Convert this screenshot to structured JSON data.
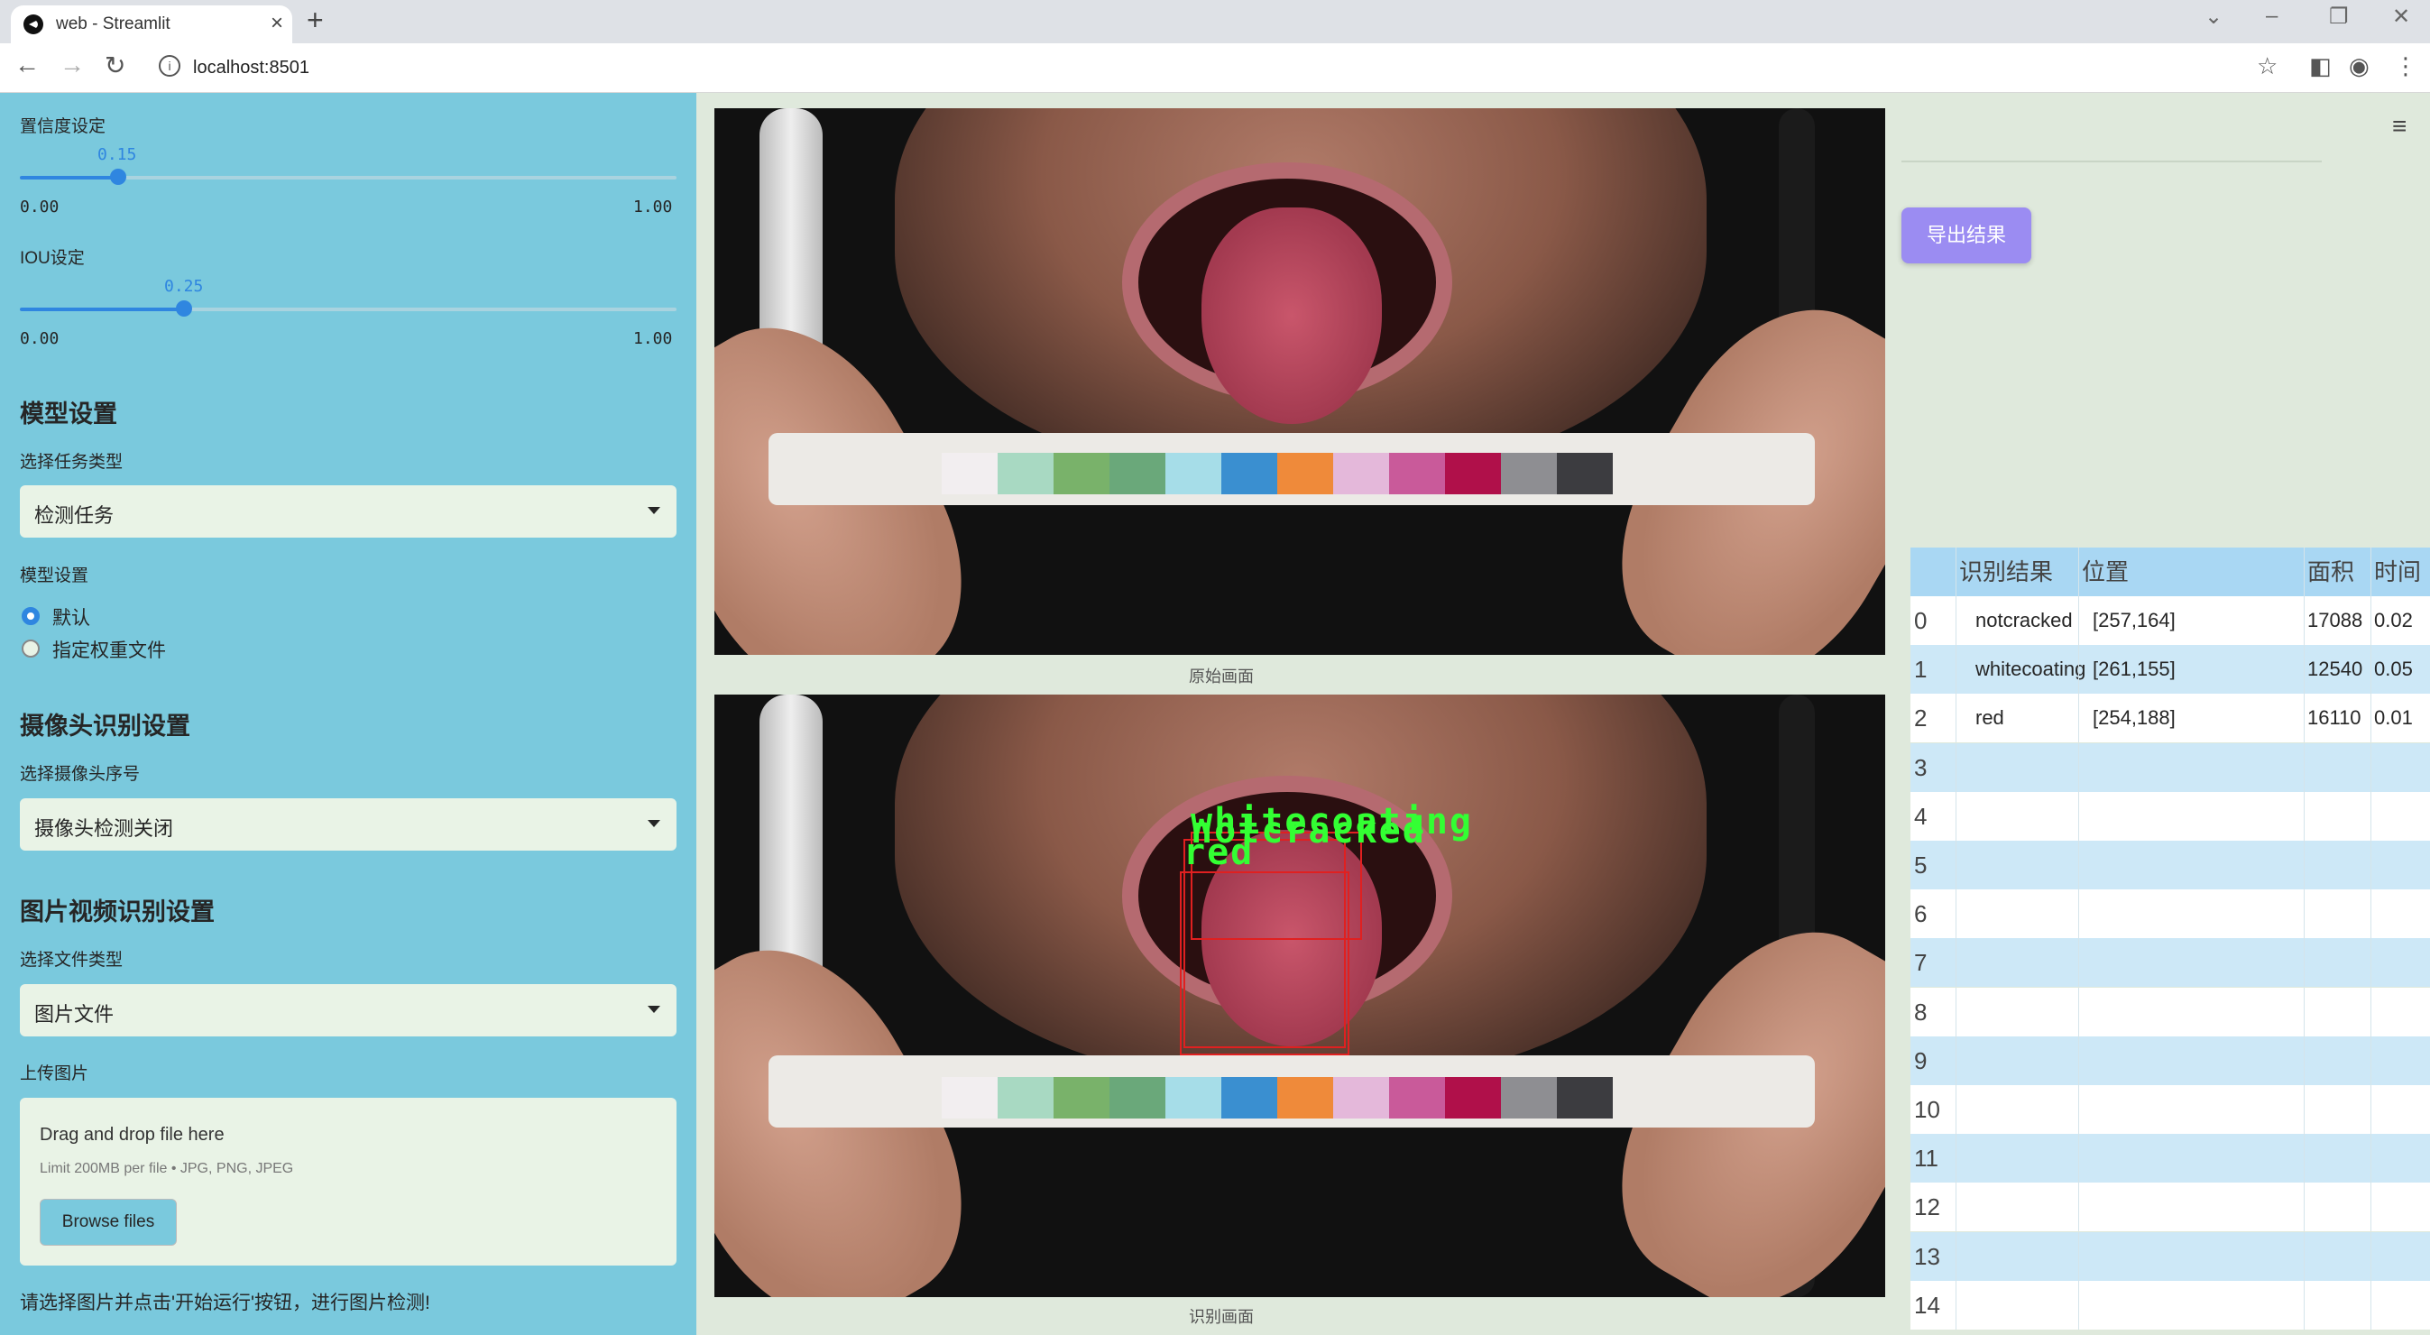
{
  "browser": {
    "tab_title": "web - Streamlit",
    "url": "localhost:8501",
    "new_tab_label": "+",
    "close_tab_label": "×"
  },
  "sidebar": {
    "confidence": {
      "label": "置信度设定",
      "value": 0.15,
      "value_text": "0.15",
      "min_text": "0.00",
      "max_text": "1.00"
    },
    "iou": {
      "label": "IOU设定",
      "value": 0.25,
      "value_text": "0.25",
      "min_text": "0.00",
      "max_text": "1.00"
    },
    "model_section_title": "模型设置",
    "task_type_label": "选择任务类型",
    "task_type_value": "检测任务",
    "model_setting_label": "模型设置",
    "radio_options": [
      "默认",
      "指定权重文件"
    ],
    "radio_selected": "默认",
    "camera_section_title": "摄像头识别设置",
    "camera_index_label": "选择摄像头序号",
    "camera_value": "摄像头检测关闭",
    "media_section_title": "图片视频识别设置",
    "file_type_label": "选择文件类型",
    "file_type_value": "图片文件",
    "upload_label": "上传图片",
    "upload_title": "Drag and drop file here",
    "upload_limit": "Limit 200MB per file • JPG, PNG, JPEG",
    "browse_label": "Browse files",
    "footer_hint": "请选择图片并点击'开始运行'按钮，进行图片检测!"
  },
  "main": {
    "original_caption": "原始画面",
    "result_caption": "识别画面",
    "detections": [
      {
        "label": "whitecoating",
        "color": "#33ff33"
      },
      {
        "label": "notcracked",
        "color": "#33ff33"
      },
      {
        "label": "red",
        "color": "#33ff33"
      }
    ],
    "swatch_colors": [
      "#f2eef0",
      "#a8d9c2",
      "#79b26a",
      "#6aa87a",
      "#a6dde8",
      "#3a8fd0",
      "#ef8a3a",
      "#e4b8da",
      "#c95a9a",
      "#b0104a",
      "#8e8e92",
      "#3c3c40"
    ]
  },
  "right": {
    "export_label": "导出结果",
    "table": {
      "headers": [
        "",
        "识别结果",
        "位置",
        "面积",
        "时间"
      ],
      "rows": [
        [
          "0",
          "notcracked",
          "[257,164]",
          "17088",
          "0.02"
        ],
        [
          "1",
          "whitecoating",
          "[261,155]",
          "12540",
          "0.05"
        ],
        [
          "2",
          "red",
          "[254,188]",
          "16110",
          "0.01"
        ],
        [
          "3",
          "",
          "",
          "",
          ""
        ],
        [
          "4",
          "",
          "",
          "",
          ""
        ],
        [
          "5",
          "",
          "",
          "",
          ""
        ],
        [
          "6",
          "",
          "",
          "",
          ""
        ],
        [
          "7",
          "",
          "",
          "",
          ""
        ],
        [
          "8",
          "",
          "",
          "",
          ""
        ],
        [
          "9",
          "",
          "",
          "",
          ""
        ],
        [
          "10",
          "",
          "",
          "",
          ""
        ],
        [
          "11",
          "",
          "",
          "",
          ""
        ],
        [
          "12",
          "",
          "",
          "",
          ""
        ],
        [
          "13",
          "",
          "",
          "",
          ""
        ],
        [
          "14",
          "",
          "",
          "",
          ""
        ]
      ],
      "header_bg": "#a9d7f3",
      "stripe_a": "#ffffff",
      "stripe_b": "#cde8f7"
    }
  }
}
